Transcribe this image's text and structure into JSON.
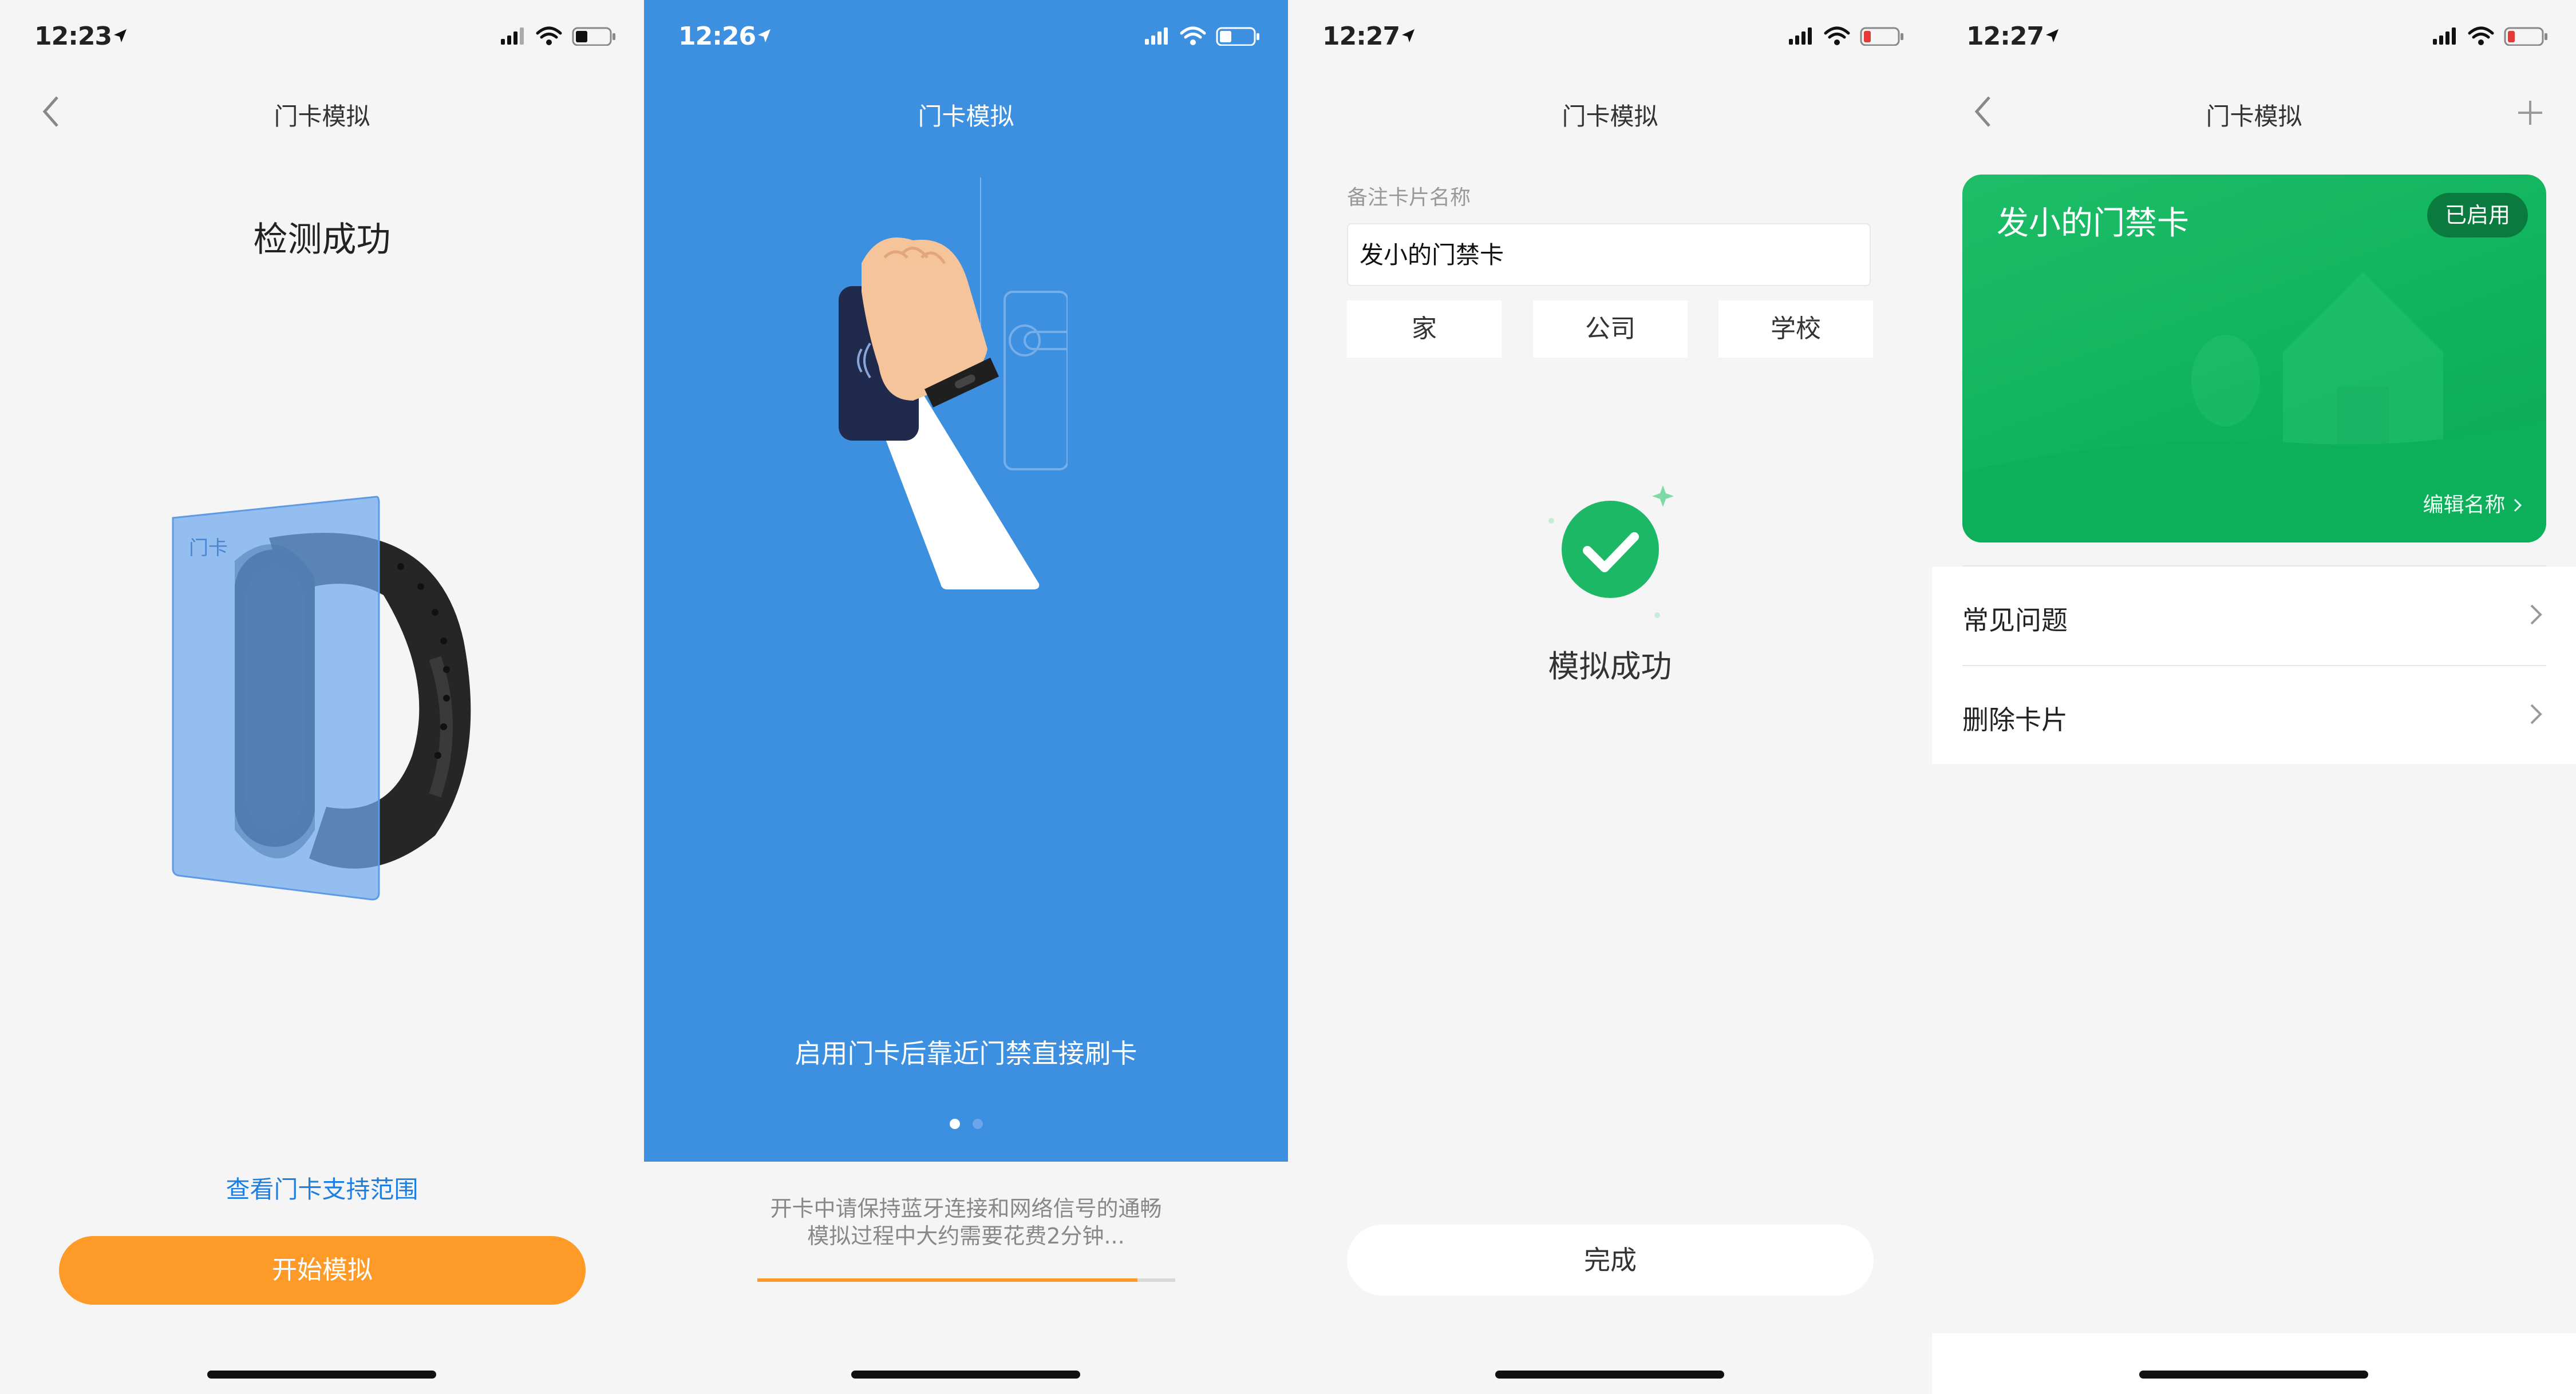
{
  "colors": {
    "accent_orange": "#fe9a28",
    "link_blue": "#1f7fe0",
    "hero_blue": "#3d8fdf",
    "card_green": "#12b862",
    "badge_green": "#0a7a3f",
    "success_green": "#1db866"
  },
  "panel1": {
    "time": "12:23",
    "title": "门卡模拟",
    "heading": "检测成功",
    "card_label": "门卡",
    "link": "查看门卡支持范围",
    "start_button": "开始模拟"
  },
  "panel2": {
    "time": "12:26",
    "title": "门卡模拟",
    "caption": "启用门卡后靠近门禁直接刷卡",
    "note_line1": "开卡中请保持蓝牙连接和网络信号的通畅",
    "note_line2": "模拟过程中大约需要花费2分钟...",
    "progress": 0.91,
    "page_dots": 2,
    "active_dot": 0
  },
  "panel3": {
    "time": "12:27",
    "title": "门卡模拟",
    "field_label": "备注卡片名称",
    "field_value": "发小的门禁卡",
    "tags": [
      "家",
      "公司",
      "学校"
    ],
    "success_text": "模拟成功",
    "done_button": "完成"
  },
  "panel4": {
    "time": "12:27",
    "title": "门卡模拟",
    "card_name": "发小的门禁卡",
    "card_status": "已启用",
    "edit_name": "编辑名称",
    "menu": [
      "常见问题",
      "删除卡片"
    ]
  },
  "icons": [
    "back-chevron-icon",
    "location-arrow-icon",
    "signal-icon",
    "wifi-icon",
    "battery-icon",
    "plus-icon",
    "check-icon",
    "chevron-right-icon"
  ]
}
